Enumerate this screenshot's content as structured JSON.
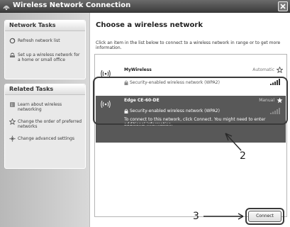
{
  "window": {
    "title": "Wireless Network Connection"
  },
  "sidebar": {
    "network_tasks": {
      "header": "Network Tasks",
      "items": [
        {
          "label": "Refresh network list"
        },
        {
          "label": "Set up a wireless network for a home or small office"
        }
      ]
    },
    "related_tasks": {
      "header": "Related Tasks",
      "items": [
        {
          "label": "Learn about wireless networking"
        },
        {
          "label": "Change the order of preferred networks"
        },
        {
          "label": "Change advanced settings"
        }
      ]
    }
  },
  "main": {
    "heading": "Choose a wireless network",
    "intro": "Click an item in the list below to connect to a wireless network in range or to get more information.",
    "networks": [
      {
        "name": "MyWireless",
        "mode": "Automatic",
        "security": "Security-enabled wireless network (WPA2)"
      },
      {
        "name": "Edge CE-60-DE",
        "mode": "Manual",
        "security": "Security-enabled wireless network (WPA2)",
        "note": "To connect to this network, click Connect. You might need to enter additional information."
      }
    ],
    "connect_label": "Connect"
  },
  "callouts": {
    "two": "2",
    "three": "3"
  },
  "colors": {
    "selected_row": "#585858",
    "titlebar": "#4a4a4a",
    "sidebar": "#c4c4c4"
  }
}
